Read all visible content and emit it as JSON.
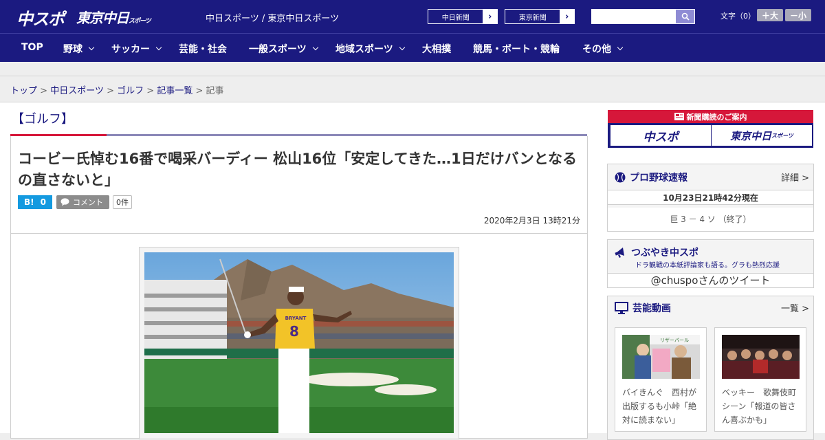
{
  "header": {
    "logo_main": "中スポ",
    "logo_tokyo": "東京中日",
    "logo_tokyo_sub": "スポーツ",
    "site_title": "中日スポーツ / 東京中日スポーツ",
    "newspaper_links": [
      {
        "label": "中日新聞",
        "arrow": "›"
      },
      {
        "label": "東京新聞",
        "arrow": "›"
      }
    ],
    "search_value": "",
    "font_size_label": "文字（0）",
    "font_larger": "＋大",
    "font_smaller": "－小"
  },
  "nav": {
    "items": [
      {
        "label": "TOP",
        "has_menu": false
      },
      {
        "label": "野球",
        "has_menu": true
      },
      {
        "label": "サッカー",
        "has_menu": true
      },
      {
        "label": "芸能・社会",
        "has_menu": false
      },
      {
        "label": "一般スポーツ",
        "has_menu": true
      },
      {
        "label": "地域スポーツ",
        "has_menu": true
      },
      {
        "label": "大相撲",
        "has_menu": false
      },
      {
        "label": "競馬・ボート・競輪",
        "has_menu": false
      },
      {
        "label": "その他",
        "has_menu": true
      }
    ]
  },
  "breadcrumb": {
    "items": [
      "トップ",
      "中日スポーツ",
      "ゴルフ",
      "記事一覧"
    ],
    "current": "記事",
    "separator": ">"
  },
  "article": {
    "category": "【ゴルフ】",
    "headline": "コービー氏悼む16番で喝采バーディー 松山16位「安定してきた…1日だけバンとなるの直さないと」",
    "hatena_label": "B!",
    "hatena_count": "0",
    "comment_label": "コメント",
    "comment_count": "0件",
    "date": "2020年2月3日 13時21分",
    "photo_jersey_name": "BRYANT",
    "photo_jersey_number": "8"
  },
  "sidebar": {
    "subscribe": {
      "title": "新聞購読のご案内",
      "logo_1": "中スポ",
      "logo_2": "東京中日",
      "logo_2_sub": "スポーツ"
    },
    "baseball": {
      "title": "プロ野球速報",
      "more": "詳細 >",
      "timestamp": "10月23日21時42分現在",
      "score": "巨 3 － 4 ソ （終了）"
    },
    "tweets": {
      "title": "つぶやき中スポ",
      "subtitle": "ドラ観戦の本紙評論家も語る。グラも熱烈応援",
      "link": "@chuspoさんのツイート"
    },
    "videos": {
      "title": "芸能動画",
      "more": "一覧 >",
      "items": [
        {
          "caption": "バイきんぐ　西村が出版するも小峠「絶対に読まない」",
          "sign_text": "リザーバール"
        },
        {
          "caption": "ベッキー　歌舞伎町シーン「報道の皆さん喜ぶかも」"
        }
      ]
    }
  },
  "colors": {
    "brand_navy": "#1b1a80",
    "accent_red": "#d6173a",
    "hatena_blue": "#149ae0"
  }
}
